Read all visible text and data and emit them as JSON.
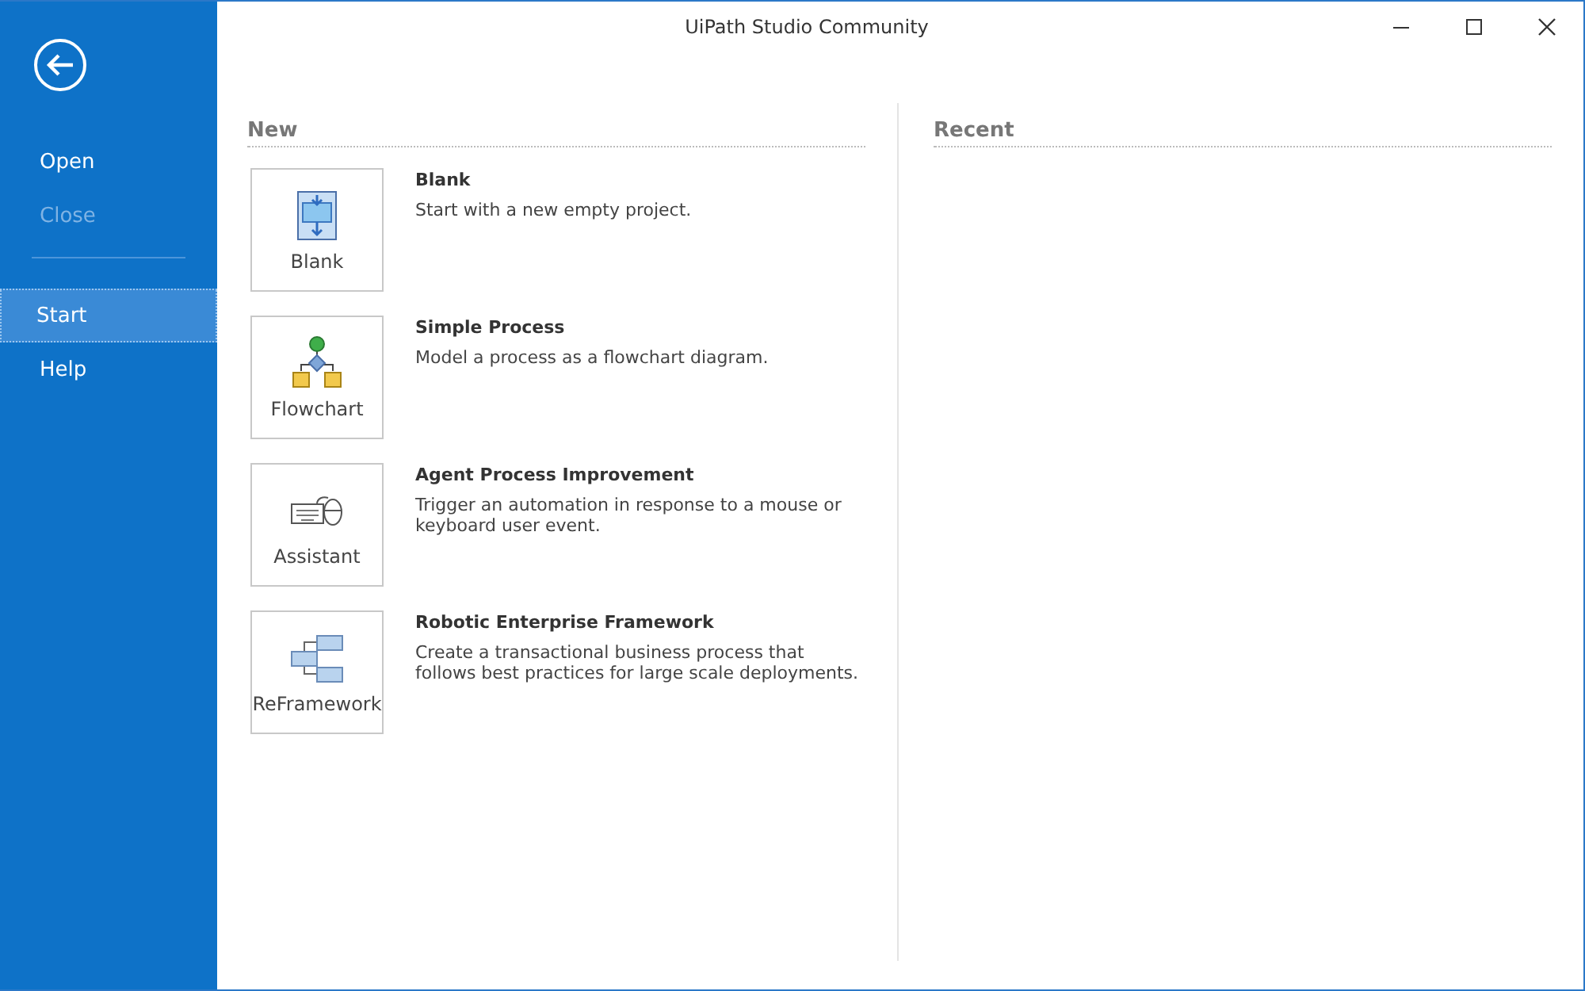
{
  "window": {
    "title": "UiPath Studio Community"
  },
  "sidebar": {
    "groups": [
      [
        {
          "label": "Open",
          "disabled": false,
          "selected": false
        },
        {
          "label": "Close",
          "disabled": true,
          "selected": false
        }
      ],
      [
        {
          "label": "Start",
          "disabled": false,
          "selected": true
        },
        {
          "label": "Help",
          "disabled": false,
          "selected": false
        }
      ]
    ]
  },
  "new_section": {
    "heading": "New",
    "templates": [
      {
        "kind": "blank",
        "tile_label": "Blank",
        "title": "Blank",
        "description": "Start with a new empty project."
      },
      {
        "kind": "flowchart",
        "tile_label": "Flowchart",
        "title": "Simple Process",
        "description": "Model a process as a flowchart diagram."
      },
      {
        "kind": "assistant",
        "tile_label": "Assistant",
        "title": "Agent Process Improvement",
        "description": "Trigger an automation in response to a mouse or keyboard user event."
      },
      {
        "kind": "reframework",
        "tile_label": "ReFramework",
        "title": "Robotic Enterprise Framework",
        "description": "Create a transactional business process that follows best practices for large scale deployments."
      }
    ]
  },
  "recent_section": {
    "heading": "Recent"
  }
}
